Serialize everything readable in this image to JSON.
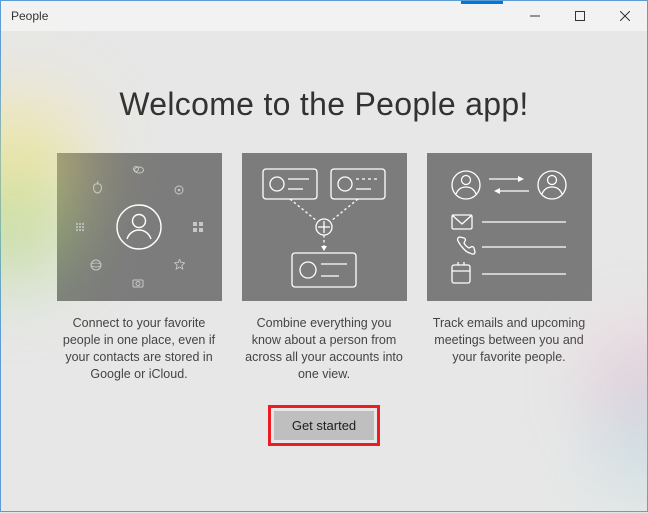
{
  "titlebar": {
    "title": "People"
  },
  "main": {
    "heading": "Welcome to the People app!",
    "cards": [
      {
        "caption": "Connect to your favorite people in one place, even if your contacts are stored in Google or iCloud."
      },
      {
        "caption": "Combine everything you know about a person from across all your accounts into one view."
      },
      {
        "caption": "Track emails and upcoming meetings between you and your favorite people."
      }
    ],
    "cta_label": "Get started"
  }
}
